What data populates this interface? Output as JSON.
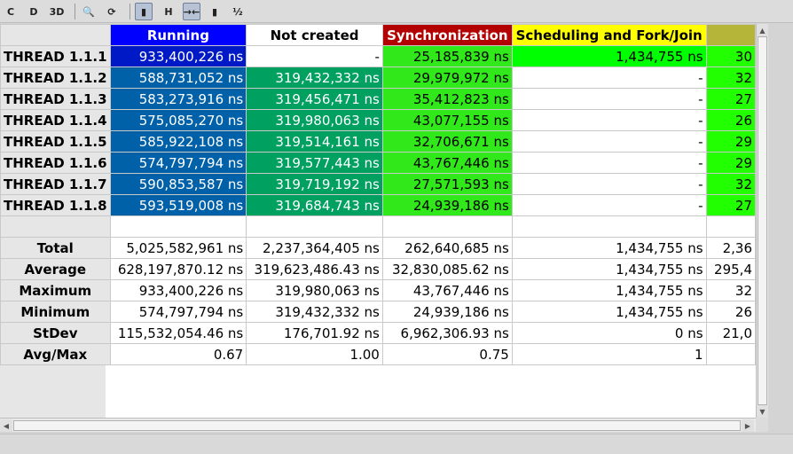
{
  "toolbar": {
    "buttons": [
      {
        "icon": "eye-c-icon",
        "glyph": "C",
        "pressed": false
      },
      {
        "icon": "eye-d-icon",
        "glyph": "D",
        "pressed": false
      },
      {
        "icon": "3d-icon",
        "glyph": "3D",
        "pressed": false
      },
      {
        "icon": "magnifier-icon",
        "glyph": "🔍",
        "pressed": false
      },
      {
        "icon": "zoom-cycle-icon",
        "glyph": "⟳",
        "pressed": false
      },
      {
        "icon": "gradient-color-icon",
        "glyph": "▮",
        "pressed": true
      },
      {
        "icon": "horizontal-icon",
        "glyph": "H",
        "pressed": false
      },
      {
        "icon": "hide-empty-cols-icon",
        "glyph": "→←",
        "pressed": true
      },
      {
        "icon": "semantic-colors-icon",
        "glyph": "▮",
        "pressed": false
      },
      {
        "icon": "fraction-icon",
        "glyph": "½",
        "pressed": false
      }
    ]
  },
  "columns": [
    {
      "label": "Running",
      "bg": "#0000ff",
      "fg": "#ffffff"
    },
    {
      "label": "Not created",
      "bg": "#ffffff",
      "fg": "#000000"
    },
    {
      "label": "Synchronization",
      "bg": "#b30000",
      "fg": "#ffffff"
    },
    {
      "label": "Scheduling and Fork/Join",
      "bg": "#ffff00",
      "fg": "#000000"
    },
    {
      "label": "",
      "bg": "#b5b53a",
      "fg": "#000000"
    }
  ],
  "colors": {
    "running_cell": "#0060a8",
    "running_cell_max": "#0019c6",
    "notcreated_cell": "#00a060",
    "sync_cell": "#30e81a",
    "sched_cell": "#00ff00",
    "col5_cell": "#22ff00"
  },
  "threads": [
    {
      "name": "THREAD 1.1.1",
      "values": [
        "933,400,226 ns",
        "-",
        "25,185,839 ns",
        "1,434,755 ns",
        "30"
      ]
    },
    {
      "name": "THREAD 1.1.2",
      "values": [
        "588,731,052 ns",
        "319,432,332 ns",
        "29,979,972 ns",
        "-",
        "32"
      ]
    },
    {
      "name": "THREAD 1.1.3",
      "values": [
        "583,273,916 ns",
        "319,456,471 ns",
        "35,412,823 ns",
        "-",
        "27"
      ]
    },
    {
      "name": "THREAD 1.1.4",
      "values": [
        "575,085,270 ns",
        "319,980,063 ns",
        "43,077,155 ns",
        "-",
        "26"
      ]
    },
    {
      "name": "THREAD 1.1.5",
      "values": [
        "585,922,108 ns",
        "319,514,161 ns",
        "32,706,671 ns",
        "-",
        "29"
      ]
    },
    {
      "name": "THREAD 1.1.6",
      "values": [
        "574,797,794 ns",
        "319,577,443 ns",
        "43,767,446 ns",
        "-",
        "29"
      ]
    },
    {
      "name": "THREAD 1.1.7",
      "values": [
        "590,853,587 ns",
        "319,719,192 ns",
        "27,571,593 ns",
        "-",
        "32"
      ]
    },
    {
      "name": "THREAD 1.1.8",
      "values": [
        "593,519,008 ns",
        "319,684,743 ns",
        "24,939,186 ns",
        "-",
        "27"
      ]
    }
  ],
  "stats": [
    {
      "name": "Total",
      "values": [
        "5,025,582,961 ns",
        "2,237,364,405 ns",
        "262,640,685 ns",
        "1,434,755 ns",
        "2,36"
      ]
    },
    {
      "name": "Average",
      "values": [
        "628,197,870.12 ns",
        "319,623,486.43 ns",
        "32,830,085.62 ns",
        "1,434,755 ns",
        "295,4"
      ]
    },
    {
      "name": "Maximum",
      "values": [
        "933,400,226 ns",
        "319,980,063 ns",
        "43,767,446 ns",
        "1,434,755 ns",
        "32"
      ]
    },
    {
      "name": "Minimum",
      "values": [
        "574,797,794 ns",
        "319,432,332 ns",
        "24,939,186 ns",
        "1,434,755 ns",
        "26"
      ]
    },
    {
      "name": "StDev",
      "values": [
        "115,532,054.46 ns",
        "176,701.92 ns",
        "6,962,306.93 ns",
        "0 ns",
        "21,0"
      ]
    },
    {
      "name": "Avg/Max",
      "values": [
        "0.67",
        "1.00",
        "0.75",
        "1",
        ""
      ]
    }
  ]
}
